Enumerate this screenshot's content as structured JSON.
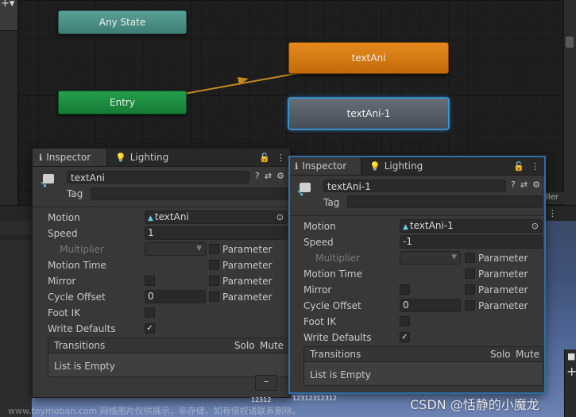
{
  "graph": {
    "nodes": {
      "any_state": "Any State",
      "entry": "Entry",
      "text_ani": "textAni",
      "text_ani_1": "textAni-1"
    },
    "colors": {
      "any_state": "#4c8f86",
      "entry": "#1a8c40",
      "text_ani": "#d97a12",
      "text_ani_1": "#555b64",
      "transition": "#c48a1e",
      "selection": "#3a9bde"
    },
    "overflow_label": "oller"
  },
  "inspector_a": {
    "tab_inspector": "Inspector",
    "tab_lighting": "Lighting",
    "name": "textAni",
    "tag_label": "Tag",
    "tag_value": "",
    "motion_label": "Motion",
    "motion_value": "textAni",
    "speed_label": "Speed",
    "speed_value": "1",
    "multiplier_label": "Multiplier",
    "multiplier_value": "",
    "parameter_label": "Parameter",
    "motion_time_label": "Motion Time",
    "mirror_label": "Mirror",
    "cycle_offset_label": "Cycle Offset",
    "cycle_offset_value": "0",
    "foot_ik_label": "Foot IK",
    "write_defaults_label": "Write Defaults",
    "transitions_label": "Transitions",
    "solo_label": "Solo",
    "mute_label": "Mute",
    "empty_label": "List is Empty",
    "minus_label": "–"
  },
  "inspector_b": {
    "tab_inspector": "Inspector",
    "tab_lighting": "Lighting",
    "name": "textAni-1",
    "tag_label": "Tag",
    "tag_value": "",
    "motion_label": "Motion",
    "motion_value": "textAni-1",
    "speed_label": "Speed",
    "speed_value": "-1",
    "multiplier_label": "Multiplier",
    "multiplier_value": "",
    "parameter_label": "Parameter",
    "motion_time_label": "Motion Time",
    "mirror_label": "Mirror",
    "cycle_offset_label": "Cycle Offset",
    "cycle_offset_value": "0",
    "foot_ik_label": "Foot IK",
    "write_defaults_label": "Write Defaults",
    "transitions_label": "Transitions",
    "solo_label": "Solo",
    "mute_label": "Mute",
    "empty_label": "List is Empty"
  },
  "icons": {
    "lock": "lock-icon",
    "menu": "kebab-menu-icon",
    "info": "info-icon",
    "settings": "settings-icon",
    "preset": "preset-icon",
    "object_picker": "object-picker-icon"
  },
  "scene": {
    "text_a": "12312",
    "text_b": "12312312312"
  },
  "watermark": {
    "left": "www.toymoban.com 网络图片仅供展示，非存储，如有侵权请联系删除。",
    "right": "CSDN @恬静的小魔龙"
  }
}
